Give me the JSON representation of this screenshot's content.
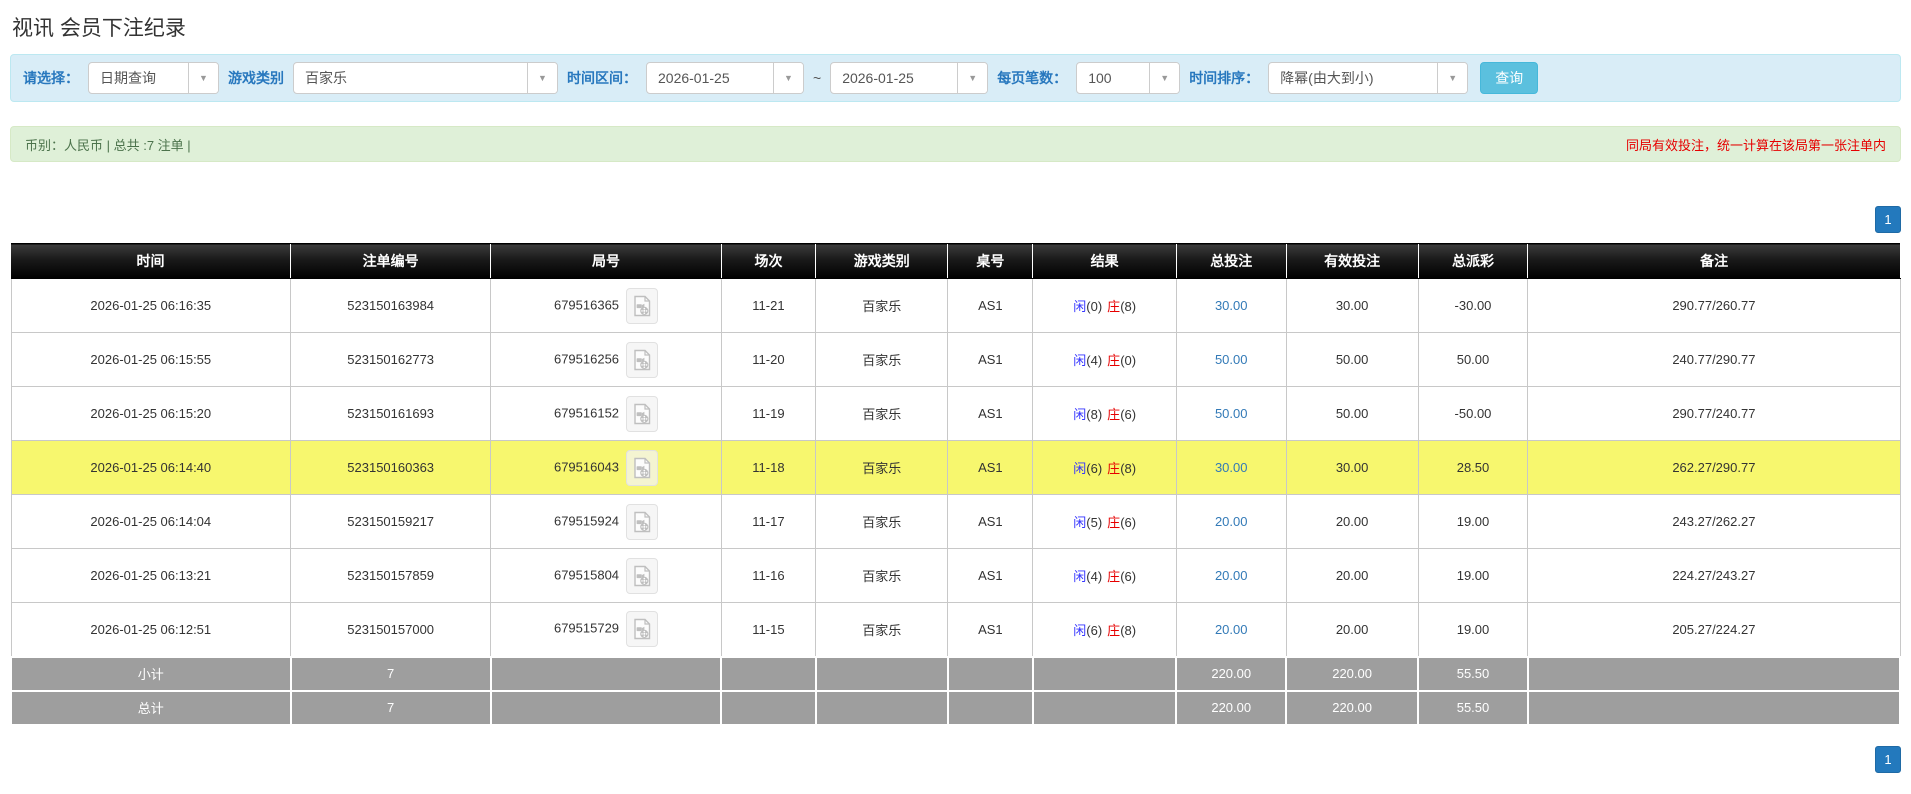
{
  "page": {
    "title": "视讯 会员下注纪录"
  },
  "filters": {
    "select_label": "请选择：",
    "select_value": "日期查询",
    "game_label": "游戏类别",
    "game_value": "百家乐",
    "range_label": "时间区间：",
    "date_from": "2026-01-25",
    "tilde": "~",
    "date_to": "2026-01-25",
    "page_size_label": "每页笔数：",
    "page_size_value": "100",
    "sort_label": "时间排序：",
    "sort_value": "降幂(由大到小)",
    "search_button": "查询"
  },
  "summary_bar": {
    "left": "币别：人民币 | 总共 :7 注单 |",
    "notice": "同局有效投注，统一计算在该局第一张注单内"
  },
  "pagination": {
    "current_page": "1"
  },
  "icons": {
    "video_record_icon": "video-file-icon",
    "dropdown_arrow": "▼"
  },
  "colors": {
    "filter_bg": "#d9edf7",
    "filter_label_blue": "#2878be",
    "search_btn_blue": "#5bc0de",
    "summary_bg": "#dff0d8",
    "notice_red": "#e60000",
    "link_blue": "#337ab7",
    "player_blue": "#3333ff",
    "banker_red": "#e60000",
    "negative_red": "#e60000",
    "highlight_yellow": "#f7f76e",
    "summary_row_gray": "#9e9e9e",
    "pagination_blue": "#2379bd",
    "header_black": "#000000"
  },
  "table": {
    "headers": [
      "时间",
      "注单编号",
      "局号",
      "场次",
      "游戏类别",
      "桌号",
      "结果",
      "总投注",
      "有效投注",
      "总派彩",
      "备注"
    ],
    "rows": [
      {
        "time": "2026-01-25 06:16:35",
        "bet_id": "523150163984",
        "round_id": "679516365",
        "session": "11-21",
        "game": "百家乐",
        "table_no": "AS1",
        "player_label": "闲",
        "player_value": "(0)",
        "banker_label": "庄",
        "banker_value": "(8)",
        "total_bet": "30.00",
        "valid_bet": "30.00",
        "payout": "-30.00",
        "payout_negative": true,
        "remark": "290.77/260.77",
        "highlight": false
      },
      {
        "time": "2026-01-25 06:15:55",
        "bet_id": "523150162773",
        "round_id": "679516256",
        "session": "11-20",
        "game": "百家乐",
        "table_no": "AS1",
        "player_label": "闲",
        "player_value": "(4)",
        "banker_label": "庄",
        "banker_value": "(0)",
        "total_bet": "50.00",
        "valid_bet": "50.00",
        "payout": "50.00",
        "payout_negative": false,
        "remark": "240.77/290.77",
        "highlight": false
      },
      {
        "time": "2026-01-25 06:15:20",
        "bet_id": "523150161693",
        "round_id": "679516152",
        "session": "11-19",
        "game": "百家乐",
        "table_no": "AS1",
        "player_label": "闲",
        "player_value": "(8)",
        "banker_label": "庄",
        "banker_value": "(6)",
        "total_bet": "50.00",
        "valid_bet": "50.00",
        "payout": "-50.00",
        "payout_negative": true,
        "remark": "290.77/240.77",
        "highlight": false
      },
      {
        "time": "2026-01-25 06:14:40",
        "bet_id": "523150160363",
        "round_id": "679516043",
        "session": "11-18",
        "game": "百家乐",
        "table_no": "AS1",
        "player_label": "闲",
        "player_value": "(6)",
        "banker_label": "庄",
        "banker_value": "(8)",
        "total_bet": "30.00",
        "valid_bet": "30.00",
        "payout": "28.50",
        "payout_negative": false,
        "remark": "262.27/290.77",
        "highlight": true
      },
      {
        "time": "2026-01-25 06:14:04",
        "bet_id": "523150159217",
        "round_id": "679515924",
        "session": "11-17",
        "game": "百家乐",
        "table_no": "AS1",
        "player_label": "闲",
        "player_value": "(5)",
        "banker_label": "庄",
        "banker_value": "(6)",
        "total_bet": "20.00",
        "valid_bet": "20.00",
        "payout": "19.00",
        "payout_negative": false,
        "remark": "243.27/262.27",
        "highlight": false
      },
      {
        "time": "2026-01-25 06:13:21",
        "bet_id": "523150157859",
        "round_id": "679515804",
        "session": "11-16",
        "game": "百家乐",
        "table_no": "AS1",
        "player_label": "闲",
        "player_value": "(4)",
        "banker_label": "庄",
        "banker_value": "(6)",
        "total_bet": "20.00",
        "valid_bet": "20.00",
        "payout": "19.00",
        "payout_negative": false,
        "remark": "224.27/243.27",
        "highlight": false
      },
      {
        "time": "2026-01-25 06:12:51",
        "bet_id": "523150157000",
        "round_id": "679515729",
        "session": "11-15",
        "game": "百家乐",
        "table_no": "AS1",
        "player_label": "闲",
        "player_value": "(6)",
        "banker_label": "庄",
        "banker_value": "(8)",
        "total_bet": "20.00",
        "valid_bet": "20.00",
        "payout": "19.00",
        "payout_negative": false,
        "remark": "205.27/224.27",
        "highlight": false
      }
    ],
    "subtotal": {
      "label": "小计",
      "count": "7",
      "total_bet": "220.00",
      "valid_bet": "220.00",
      "payout": "55.50"
    },
    "grand_total": {
      "label": "总计",
      "count": "7",
      "total_bet": "220.00",
      "valid_bet": "220.00",
      "payout": "55.50"
    }
  }
}
